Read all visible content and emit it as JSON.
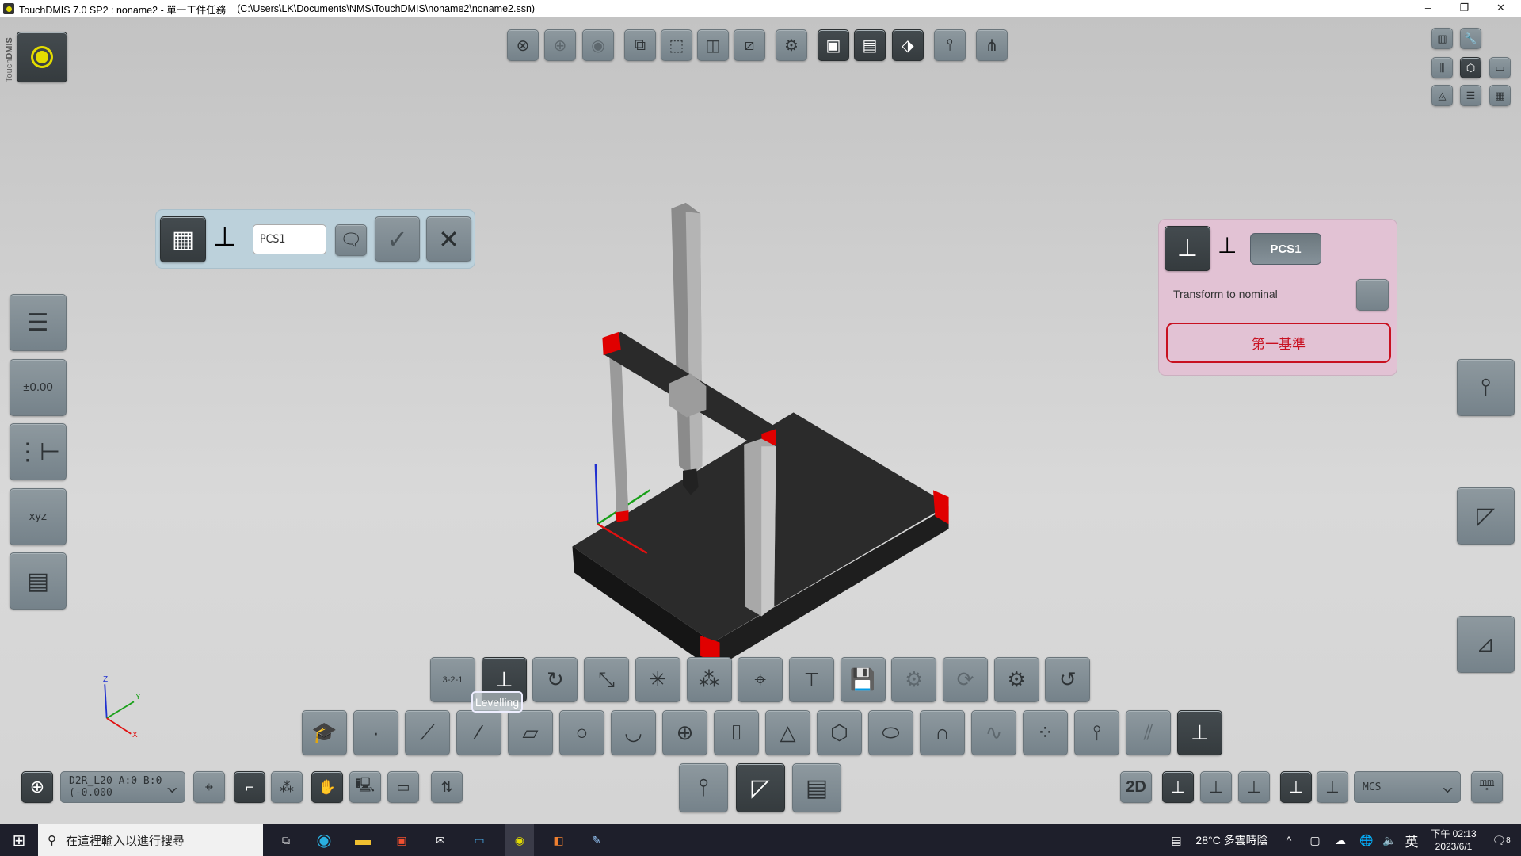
{
  "window": {
    "app_title": "TouchDMIS 7.0 SP2 : noname2 - 單一工件任務",
    "file_path": "(C:\\Users\\LK\\Documents\\NMS\\TouchDMIS\\noname2\\noname2.ssn)",
    "minimize": "–",
    "restore": "❐",
    "close": "✕"
  },
  "logo": {
    "text_light": "Touch",
    "text_bold": "DMIS"
  },
  "top_toolbar": [
    {
      "icon": "zoom-fit-icon",
      "glyph": "⊗"
    },
    {
      "icon": "zoom-target-icon",
      "glyph": "⊕",
      "faded": true
    },
    {
      "icon": "view-eye-icon",
      "glyph": "◉",
      "faded": true
    },
    {
      "icon": "view-cube-front-icon",
      "glyph": "⧉"
    },
    {
      "icon": "view-cube-top-icon",
      "glyph": "⬚"
    },
    {
      "icon": "view-cube-side-icon",
      "glyph": "◫"
    },
    {
      "icon": "view-cube-section-icon",
      "glyph": "⧄"
    },
    {
      "icon": "machine-axes-icon",
      "glyph": "⚙"
    },
    {
      "icon": "solid-view-icon",
      "glyph": "▣",
      "dark": true
    },
    {
      "icon": "wireframe-layers-icon",
      "glyph": "▤",
      "dark": true
    },
    {
      "icon": "feature-view-icon",
      "glyph": "⬗",
      "dark": true
    },
    {
      "icon": "probe-compare-icon",
      "glyph": "⫯"
    },
    {
      "icon": "path-tree-icon",
      "glyph": "⋔"
    }
  ],
  "top_right": [
    {
      "icon": "fixture-icon",
      "glyph": "▥"
    },
    {
      "icon": "wrench-icon",
      "glyph": "🔧"
    },
    {
      "icon": "probes-icon",
      "glyph": "⫼"
    },
    {
      "icon": "cube-icon",
      "glyph": "⬡",
      "dark": true
    },
    {
      "icon": "layout-icon",
      "glyph": "▭"
    },
    {
      "icon": "cad-shapes-icon",
      "glyph": "◬"
    },
    {
      "icon": "report-list-icon",
      "glyph": "☰"
    },
    {
      "icon": "cad-report-icon",
      "glyph": "▦"
    }
  ],
  "left_sidebar": [
    {
      "icon": "program-list-icon",
      "glyph": "☰"
    },
    {
      "icon": "tolerance-icon",
      "glyph": "±0.00"
    },
    {
      "icon": "tree-icon",
      "glyph": "⋮⊢"
    },
    {
      "icon": "xyz-readout-icon",
      "glyph": "xyz"
    },
    {
      "icon": "table-view-icon",
      "glyph": "▤"
    }
  ],
  "pcs_dialog": {
    "input_value": "PCS1",
    "icons": [
      "table-icon",
      "axes-icon",
      "comment-icon",
      "confirm-icon",
      "cancel-icon"
    ]
  },
  "nominal_panel": {
    "pcs_label": "PCS1",
    "transform_label": "Transform to nominal",
    "datum_button": "第一基準"
  },
  "right_sidebar": [
    {
      "icon": "probe-tool-icon",
      "glyph": "⫯"
    },
    {
      "icon": "geometry-construct-icon",
      "glyph": "◸"
    },
    {
      "icon": "dimension-icon",
      "glyph": "⊿"
    }
  ],
  "tooltip": "Levelling",
  "alignment_toolbar": [
    {
      "icon": "alignment-321-icon",
      "glyph": "3-2-1"
    },
    {
      "icon": "levelling-icon",
      "glyph": "⊥",
      "dark": true
    },
    {
      "icon": "rotate-axis-icon",
      "glyph": "↻"
    },
    {
      "icon": "translate-origin-icon",
      "glyph": "⤡"
    },
    {
      "icon": "best-fit-icon",
      "glyph": "✳"
    },
    {
      "icon": "rps-alignment-icon",
      "glyph": "⁂"
    },
    {
      "icon": "origin-point-icon",
      "glyph": "⌖"
    },
    {
      "icon": "probe-datum-icon",
      "glyph": "⍑"
    },
    {
      "icon": "save-load-alignment-icon",
      "glyph": "💾"
    },
    {
      "icon": "cad-alignment-icon",
      "glyph": "⚙",
      "faded": true
    },
    {
      "icon": "rotary-alignment-icon",
      "glyph": "⟳",
      "faded": true
    },
    {
      "icon": "fixture-alignment-icon",
      "glyph": "⚙"
    },
    {
      "icon": "recall-alignment-icon",
      "glyph": "↺"
    }
  ],
  "feature_toolbar": [
    {
      "icon": "graduation-cap-icon",
      "glyph": "🎓"
    },
    {
      "icon": "point-icon",
      "glyph": "·"
    },
    {
      "icon": "edge-point-icon",
      "glyph": "⟋"
    },
    {
      "icon": "line-icon",
      "glyph": "∕"
    },
    {
      "icon": "plane-icon",
      "glyph": "▱"
    },
    {
      "icon": "circle-icon",
      "glyph": "○"
    },
    {
      "icon": "arc-icon",
      "glyph": "◡"
    },
    {
      "icon": "sphere-icon",
      "glyph": "⊕"
    },
    {
      "icon": "cylinder-icon",
      "glyph": "⌷"
    },
    {
      "icon": "cone-icon",
      "glyph": "△"
    },
    {
      "icon": "polygon-icon",
      "glyph": "⬡"
    },
    {
      "icon": "slot-icon",
      "glyph": "⬭"
    },
    {
      "icon": "torus-icon",
      "glyph": "∩"
    },
    {
      "icon": "curve-icon",
      "glyph": "∿",
      "faded": true
    },
    {
      "icon": "surface-icon",
      "glyph": "⁘"
    },
    {
      "icon": "probe-settings-icon",
      "glyph": "⫯"
    },
    {
      "icon": "section-icon",
      "glyph": "⫽",
      "faded": true
    },
    {
      "icon": "coordinate-system-icon",
      "glyph": "⊥",
      "dark": true
    }
  ],
  "mode_toolbar": [
    {
      "icon": "probe-tool-icon",
      "glyph": "⫯"
    },
    {
      "icon": "construct-icon",
      "glyph": "◸",
      "dark": true
    },
    {
      "icon": "report-icon",
      "glyph": "▤"
    }
  ],
  "bottom_left": {
    "probe_icon": "probe-add-icon",
    "probe_select": "D2R_L20 A:0 B:0 (-0.000",
    "buttons": [
      {
        "icon": "probe-calibrate-icon",
        "glyph": "⌖"
      },
      {
        "icon": "path-icon",
        "glyph": "⌐",
        "dark": true
      },
      {
        "icon": "binary-path-icon",
        "glyph": "⁂"
      },
      {
        "icon": "manual-hand-icon",
        "glyph": "✋",
        "dark": true
      },
      {
        "icon": "pc-hand-icon",
        "glyph": "🖳"
      },
      {
        "icon": "monitor-icon",
        "glyph": "▭"
      },
      {
        "icon": "probe-change-icon",
        "glyph": "⇅"
      }
    ]
  },
  "bottom_right": {
    "view_2d": "2D",
    "buttons": [
      {
        "icon": "workplane-icon",
        "glyph": "⊥",
        "dark": true
      },
      {
        "icon": "plane-xz-icon",
        "glyph": "⊥"
      },
      {
        "icon": "plane-yz-icon",
        "glyph": "⊥"
      },
      {
        "icon": "axes-icon",
        "glyph": "⊥",
        "dark": true
      },
      {
        "icon": "polar-axes-icon",
        "glyph": "⊥"
      }
    ],
    "cs_select": "MCS",
    "units": "mm"
  },
  "triad": {
    "x": "X",
    "y": "Y",
    "z": "Z"
  },
  "taskbar": {
    "search_placeholder": "在這裡輸入以進行搜尋",
    "weather": "28°C 多雲時陰",
    "ime": "英",
    "time": "下午 02:13",
    "date": "2023/6/1",
    "notifications": "8"
  }
}
